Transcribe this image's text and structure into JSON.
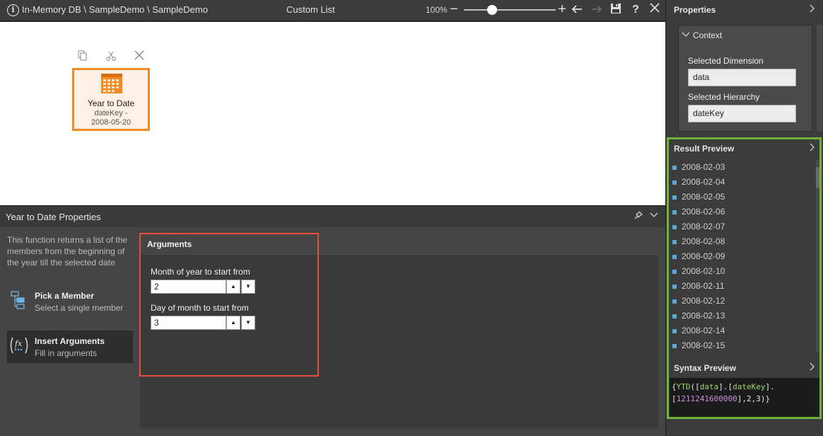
{
  "toolbar": {
    "breadcrumb": "In-Memory DB \\ SampleDemo \\ SampleDemo",
    "title": "Custom List",
    "zoom_label": "100%",
    "zoom_level_percent": 100
  },
  "canvas": {
    "node": {
      "title": "Year to Date",
      "subtitle_line1": "dateKey -",
      "subtitle_line2": "2008-05-20"
    }
  },
  "lower_panel": {
    "title": "Year to Date Properties",
    "description": "This function returns a list of the members from the beginning of the year till the selected date",
    "steps": [
      {
        "title": "Pick a Member",
        "subtitle": "Select a single member"
      },
      {
        "title": "Insert Arguments",
        "subtitle": "Fill in arguments"
      }
    ],
    "arguments": {
      "header": "Arguments",
      "month_label": "Month of year to start from",
      "month_value": "2",
      "day_label": "Day of month to start from",
      "day_value": "3"
    }
  },
  "properties": {
    "title": "Properties",
    "context": {
      "title": "Context",
      "dimension_label": "Selected Dimension",
      "dimension_value": "data",
      "hierarchy_label": "Selected Hierarchy",
      "hierarchy_value": "dateKey"
    }
  },
  "result_preview": {
    "title": "Result Preview",
    "items": [
      "2008-02-03",
      "2008-02-04",
      "2008-02-05",
      "2008-02-06",
      "2008-02-07",
      "2008-02-08",
      "2008-02-09",
      "2008-02-10",
      "2008-02-11",
      "2008-02-12",
      "2008-02-13",
      "2008-02-14",
      "2008-02-15"
    ]
  },
  "syntax_preview": {
    "title": "Syntax Preview",
    "t1": "{",
    "t2": "YTD",
    "t3": "([",
    "t4": "data",
    "t5": "].[",
    "t6": "dateKey",
    "t7": "].",
    "t8": "[",
    "t9": "1211241600000",
    "t10": "],2,3)}"
  },
  "colors": {
    "accent_orange": "#f08a24",
    "highlight_red": "#e74c3c",
    "highlight_green": "#6fb33b",
    "list_bullet": "#5aa9d8"
  }
}
